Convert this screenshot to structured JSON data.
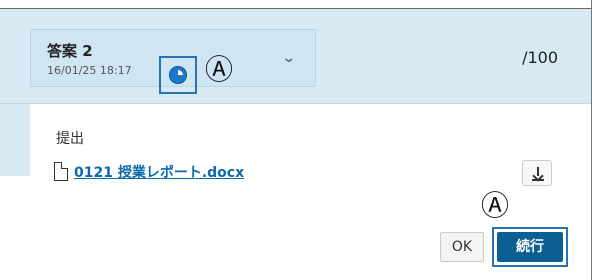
{
  "header": {
    "version_title": "答案 2",
    "version_date": "16/01/25 18:17",
    "status_icon": "progress-pie-icon",
    "marker_label": "Ⓐ",
    "dropdown_icon": "chevron-down-icon",
    "score": "/100"
  },
  "submission": {
    "label": "提出",
    "file_name": "0121 授業レポート.docx",
    "file_icon": "document-icon",
    "download_icon": "download-icon"
  },
  "actions": {
    "ok_label": "OK",
    "continue_label": "続行",
    "marker_label": "Ⓐ"
  },
  "colors": {
    "header_background": "#d8ebf4",
    "accent_blue": "#0b5f93",
    "link_blue": "#0b6aa8",
    "highlight_border": "#2a72b0"
  }
}
